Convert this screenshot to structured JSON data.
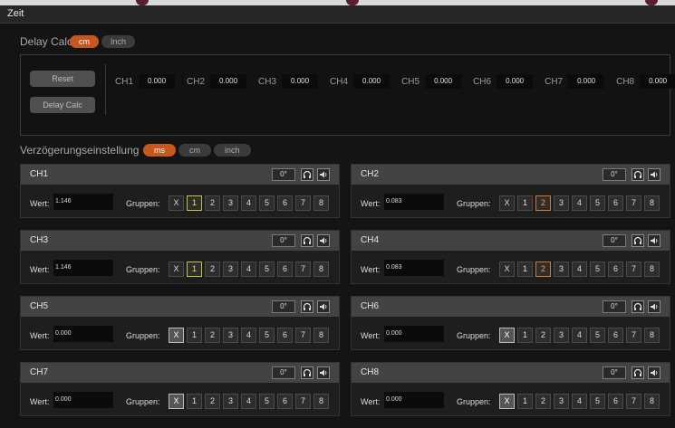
{
  "window": {
    "title": "Zeit"
  },
  "delay_calc": {
    "title": "Delay Calc",
    "units": [
      {
        "label": "cm",
        "active": true
      },
      {
        "label": "Inch",
        "active": false
      }
    ],
    "reset_label": "Reset",
    "calc_label": "Delay Calc",
    "channels": [
      {
        "name": "CH1",
        "value": "0.000"
      },
      {
        "name": "CH2",
        "value": "0.000"
      },
      {
        "name": "CH3",
        "value": "0.000"
      },
      {
        "name": "CH4",
        "value": "0.000"
      },
      {
        "name": "CH5",
        "value": "0.000"
      },
      {
        "name": "CH6",
        "value": "0.000"
      },
      {
        "name": "CH7",
        "value": "0.000"
      },
      {
        "name": "CH8",
        "value": "0.000"
      }
    ]
  },
  "delay_setting": {
    "title": "Verzögerungseinstellung",
    "units": [
      {
        "label": "ms",
        "active": true
      },
      {
        "label": "cm",
        "active": false
      },
      {
        "label": "inch",
        "active": false
      }
    ],
    "wert_label": "Wert:",
    "gruppen_label": "Gruppen:",
    "group_buttons": [
      "X",
      "1",
      "2",
      "3",
      "4",
      "5",
      "6",
      "7",
      "8"
    ],
    "phase_label": "0°",
    "channels": [
      {
        "name": "CH1",
        "value": "1.146",
        "group": "1",
        "group_color": "#c7c23a"
      },
      {
        "name": "CH2",
        "value": "0.083",
        "group": "2",
        "group_color": "#d07a2a"
      },
      {
        "name": "CH3",
        "value": "1.146",
        "group": "1",
        "group_color": "#c7c23a"
      },
      {
        "name": "CH4",
        "value": "0.083",
        "group": "2",
        "group_color": "#d07a2a"
      },
      {
        "name": "CH5",
        "value": "0.000",
        "group": "X"
      },
      {
        "name": "CH6",
        "value": "0.000",
        "group": "X"
      },
      {
        "name": "CH7",
        "value": "0.000",
        "group": "X"
      },
      {
        "name": "CH8",
        "value": "0.000",
        "group": "X"
      }
    ]
  },
  "colors": {
    "accent": "#c8561f",
    "header": "#434343",
    "background": "#141414"
  },
  "icons": {
    "headphone": "headphone-icon",
    "speaker": "speaker-icon"
  }
}
